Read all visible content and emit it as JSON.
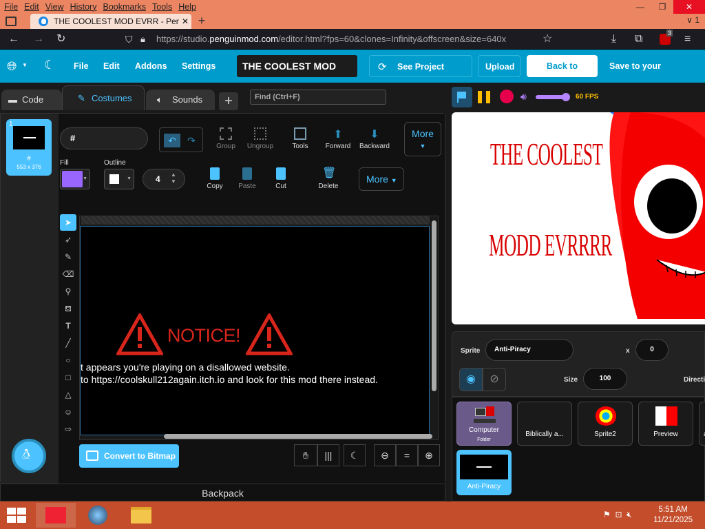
{
  "browser": {
    "menu": [
      "File",
      "Edit",
      "View",
      "History",
      "Bookmarks",
      "Tools",
      "Help"
    ],
    "tab_title": "THE COOLEST MOD EVRR - Pen",
    "tab_count_label": "1",
    "url_prefix": "https://studio.",
    "url_domain": "penguinmod.com",
    "url_rest": "/editor.html?fps=60&clones=Infinity&offscreen&size=640x",
    "ext_badge": "3"
  },
  "header": {
    "menu": [
      "File",
      "Edit",
      "Addons",
      "Settings"
    ],
    "project_title": "THE COOLEST MOD EV...",
    "see_project": "See Project Page",
    "upload": "Upload",
    "home": "Back to Home",
    "save": "Save to your computer"
  },
  "tabs": {
    "code": "Code",
    "costumes": "Costumes",
    "sounds": "Sounds",
    "find_placeholder": "Find (Ctrl+F)"
  },
  "costume": {
    "index": "1",
    "name": "#",
    "size": "553 x 376",
    "field_value": "#",
    "fill_label": "Fill",
    "outline_label": "Outline",
    "stroke_width": "4",
    "fill_color": "#9966ff",
    "outline_color": "#ffffff"
  },
  "toolbar": {
    "group": "Group",
    "ungroup": "Ungroup",
    "tools": "Tools",
    "forward": "Forward",
    "backward": "Backward",
    "more": "More",
    "copy": "Copy",
    "paste": "Paste",
    "cut": "Cut",
    "delete": "Delete"
  },
  "canvas": {
    "notice": "NOTICE!",
    "line1": "t appears you're playing on a disallowed website.",
    "line2": "to https://coolskull212again.itch.io and look for this mod there instead.",
    "convert": "Convert to Bitmap"
  },
  "backpack": "Backpack",
  "stage": {
    "fps": "60 FPS",
    "line1": "THE COOLEST",
    "line2": "MODD EVRRRR"
  },
  "sprite": {
    "label": "Sprite",
    "name": "Anti-Piracy",
    "x_label": "x",
    "x": "0",
    "size_label": "Size",
    "size": "100",
    "direction_label": "Directi"
  },
  "sprites": [
    {
      "name": "Computer",
      "sub": "Folder"
    },
    {
      "name": "Biblically a..."
    },
    {
      "name": "Sprite2"
    },
    {
      "name": "Preview"
    },
    {
      "name": "a"
    },
    {
      "name": "Anti-Piracy"
    }
  ],
  "taskbar": {
    "time": "5:51 AM",
    "date": "11/21/2025"
  }
}
